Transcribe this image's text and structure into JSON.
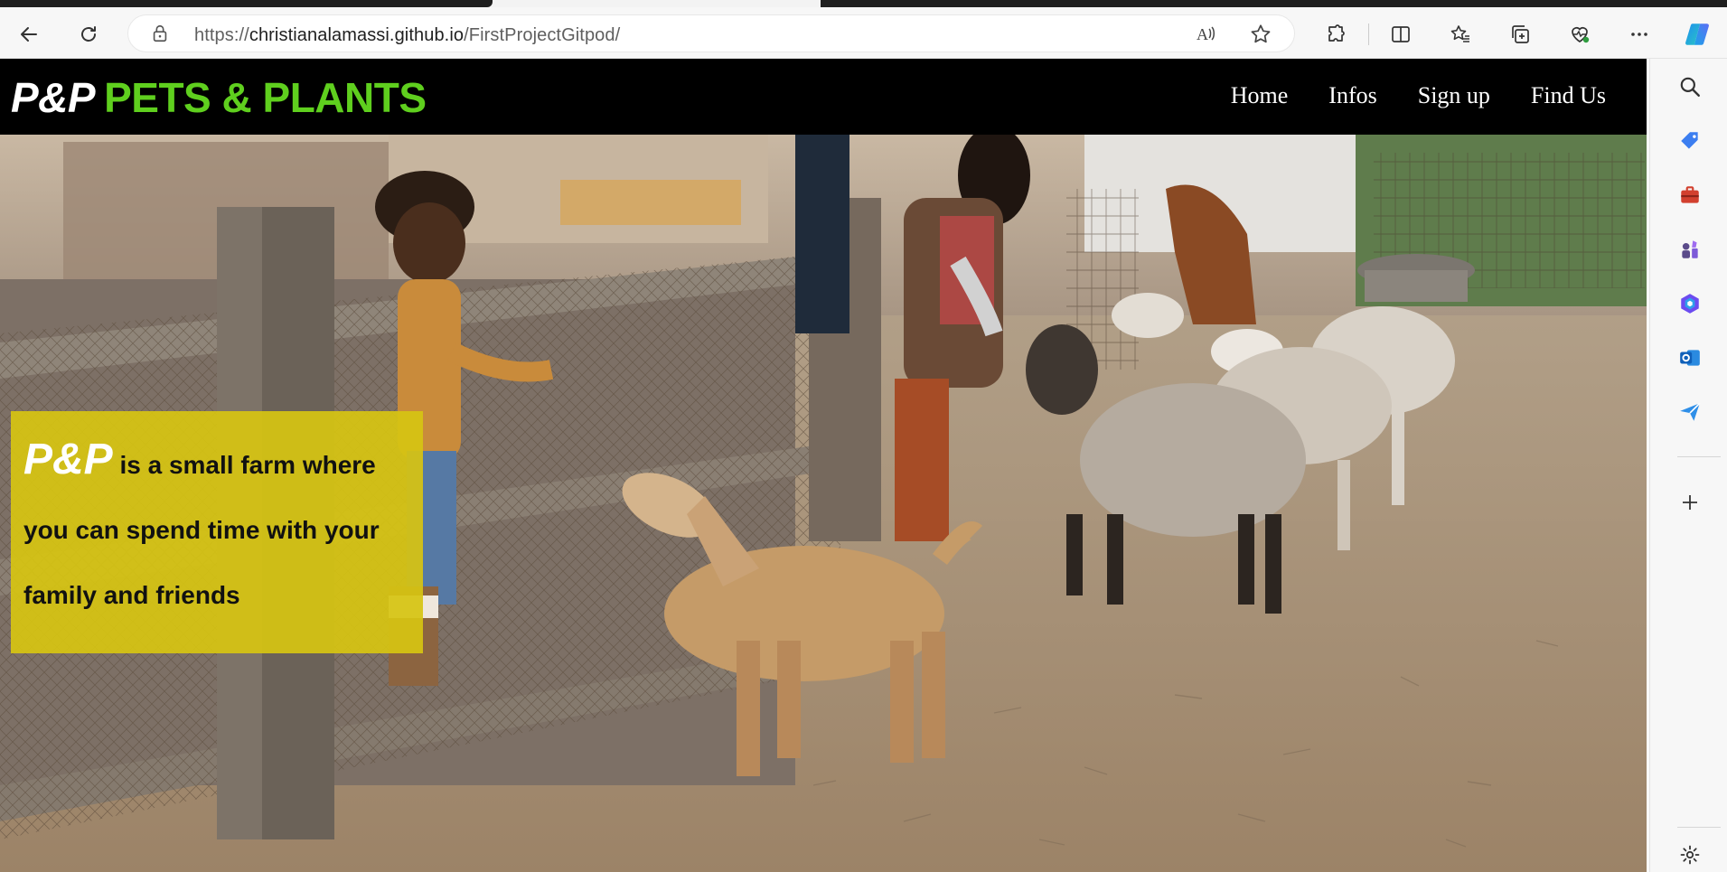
{
  "browser": {
    "url_prefix": "https://",
    "url_host": "christianalamassi.github.io",
    "url_path": "/FirstProjectGitpod/"
  },
  "site": {
    "logo_short": "P&P",
    "logo_name": "PETS & PLANTS",
    "nav": [
      "Home",
      "Infos",
      "Sign up",
      "Find Us"
    ],
    "intro_brand": "P&P",
    "intro_text_1": "is a small farm where",
    "intro_text_2": "you can spend time with your",
    "intro_text_3": "family and friends"
  },
  "colors": {
    "header_bg": "#000000",
    "logo_green": "#5fcf1e",
    "intro_bg": "#d6c412"
  },
  "icons": {
    "toolbar": [
      "back-icon",
      "refresh-icon",
      "lock-icon",
      "read-aloud-icon",
      "favorite-icon",
      "extensions-icon",
      "split-screen-icon",
      "favorites-icon",
      "collections-icon",
      "browser-essentials-icon",
      "more-icon",
      "copilot-icon"
    ],
    "sidebar": [
      "search-icon",
      "shopping-icon",
      "tools-icon",
      "games-icon",
      "office-icon",
      "outlook-icon",
      "drop-icon",
      "add-icon",
      "settings-icon"
    ]
  }
}
